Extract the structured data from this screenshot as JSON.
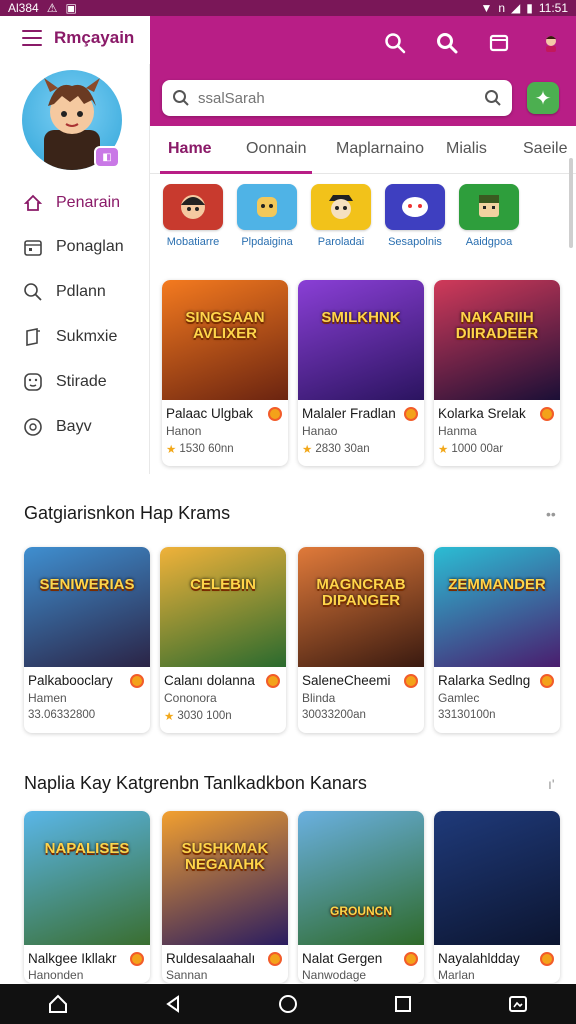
{
  "status": {
    "time": "11:51",
    "left_text": "Al384",
    "left_icons": [
      "warning-icon",
      "image-icon"
    ],
    "right_icons": [
      "wifi-icon",
      "nfc-icon",
      "signal-icon",
      "battery-icon"
    ]
  },
  "app": {
    "title": "Rmçayain",
    "brand_color": "#b81e86"
  },
  "search": {
    "placeholder": "ssalSarah"
  },
  "sidebar": {
    "items": [
      {
        "label": "Penarain",
        "icon": "home-icon",
        "active": true
      },
      {
        "label": "Ponaglan",
        "icon": "calendar-icon",
        "active": false
      },
      {
        "label": "Pdlann",
        "icon": "search-icon",
        "active": false
      },
      {
        "label": "Sukmxie",
        "icon": "book-icon",
        "active": false
      },
      {
        "label": "Stirade",
        "icon": "face-icon",
        "active": false
      },
      {
        "label": "Bayv",
        "icon": "circle-icon",
        "active": false
      }
    ]
  },
  "tabs": [
    {
      "label": "Hame",
      "active": true
    },
    {
      "label": "Oonnain",
      "active": false
    },
    {
      "label": "Maplarnaino",
      "active": false
    },
    {
      "label": "Mialis",
      "active": false
    },
    {
      "label": "Saeile",
      "active": false
    }
  ],
  "categories": [
    {
      "label": "Mobatiarre",
      "color": "#c83a2e"
    },
    {
      "label": "Plpdaigina",
      "color": "#4fb3e6"
    },
    {
      "label": "Paroladai",
      "color": "#f2c21a"
    },
    {
      "label": "Sesapolnis",
      "color": "#3e3fc0"
    },
    {
      "label": "Aaidgpoa",
      "color": "#2e9e3c"
    }
  ],
  "featured": [
    {
      "art_title": "SINGSAAN AVLIXER",
      "name": "Palaac Ulgbak",
      "sub": "Hanon",
      "meta": "1530 60nn",
      "art": [
        "#f47a1f",
        "#6b2410"
      ]
    },
    {
      "art_title": "SMILKHNK",
      "name": "Malaler Fradlan",
      "sub": "Hanao",
      "meta": "2830 30an",
      "art": [
        "#8a3fd6",
        "#2b1460"
      ]
    },
    {
      "art_title": "NAKARIIH DIIRADEER",
      "name": "Kolarka Srelak",
      "sub": "Hanma",
      "meta": "1000 00ar",
      "art": [
        "#d03a5a",
        "#1b0f36"
      ]
    }
  ],
  "section1": {
    "title": "Gatgiarisnkon Hap Krams",
    "more": "••"
  },
  "row1": [
    {
      "art_title": "SENIWERIAS",
      "name": "Palkabooclary",
      "sub": "Hamen",
      "meta": "33.06332800",
      "art": [
        "#3f8fd0",
        "#2b2446"
      ]
    },
    {
      "art_title": "CELEBIN",
      "name": "Calanı dolanna",
      "sub": "Cononora",
      "meta": "3030 100n",
      "art": [
        "#f0b23a",
        "#2a6a2e"
      ]
    },
    {
      "art_title": "MAGNCRAB DIPANGER",
      "name": "SaleneCheemi",
      "sub": "Blinda",
      "meta": "30033200an",
      "art": [
        "#e07a3a",
        "#3a1a10"
      ]
    },
    {
      "art_title": "ZEMMANDER",
      "name": "Ralarka Sedlng",
      "sub": "Gamlec",
      "meta": "33130100n",
      "art": [
        "#2bbdd4",
        "#4a1d6e"
      ]
    }
  ],
  "section2": {
    "title": "Naplia Kay Katgrenbn Tanlkadkbon Kanars",
    "more": "ı'"
  },
  "row2": [
    {
      "art_title": "NAPALISES",
      "name": "Nalkgee Ikllakr",
      "sub": "Hanonden",
      "meta": "",
      "art": [
        "#5ab6e8",
        "#3a6e30"
      ]
    },
    {
      "art_title": "SUSHKMAK NEGAIAHK",
      "name": "Ruldesalaahalı",
      "sub": "Sannan",
      "meta": "",
      "art": [
        "#f2a030",
        "#2a1c60"
      ]
    },
    {
      "art_title": "GROUNCN",
      "name": "Nalat Gergen",
      "sub": "Nanwodage",
      "meta": "",
      "art": [
        "#6ab0e0",
        "#2e6a2a"
      ]
    },
    {
      "art_title": "",
      "name": "Nayalahldday",
      "sub": "Marlan",
      "meta": "",
      "art": [
        "#1f3a7a",
        "#0c1530"
      ]
    }
  ]
}
